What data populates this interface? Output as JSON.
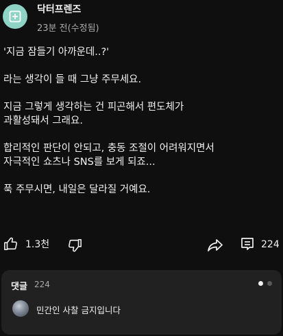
{
  "post": {
    "author": "닥터프렌즈",
    "meta": "23분 전(수정됨)",
    "paragraphs": [
      "'지금 잠들기 아까운데..?'",
      "라는 생각이 들 때 그냥 주무세요.",
      "지금 그렇게 생각하는 건 피곤해서 편도체가\n과활성돼서 그래요.",
      "합리적인 판단이 안되고, 충동 조절이 어려워지면서\n자극적인 쇼츠나 SNS를 보게 되죠...",
      "푹 주무시면, 내일은 달라질 거예요."
    ]
  },
  "actions": {
    "like_count": "1.3천",
    "comment_count": "224"
  },
  "comments": {
    "title": "댓글",
    "count": "224",
    "top_comment": "민간인 사찰 금지입니다"
  },
  "colors": {
    "background": "#0f0f0f",
    "panel": "#212121",
    "avatar": "#8fd3c6",
    "text": "#f1f1f1",
    "muted": "#aaaaaa"
  },
  "icons": [
    "community-post-icon",
    "thumbs-up-icon",
    "thumbs-down-icon",
    "share-icon",
    "comments-icon"
  ]
}
